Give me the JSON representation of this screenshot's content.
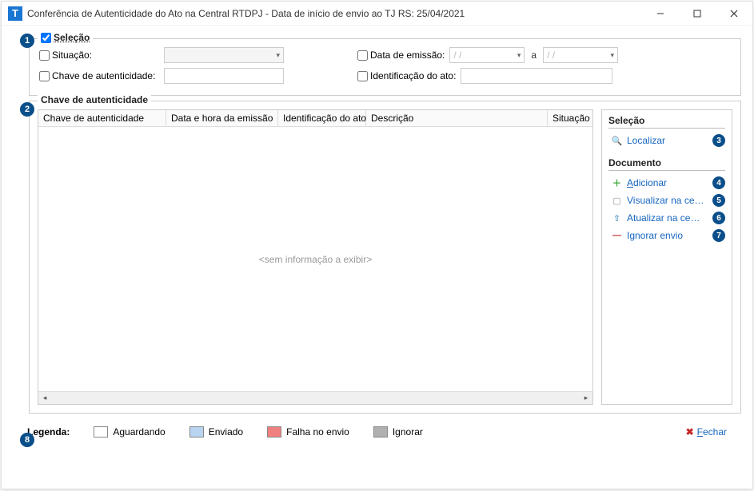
{
  "titlebar": {
    "app_icon_letter": "T",
    "title": "Conferência de Autenticidade do Ato na Central RTDPJ - Data de início de envio ao TJ RS: 25/04/2021"
  },
  "filters": {
    "legend": "Seleção",
    "situacao_label": "Situação:",
    "chave_label": "Chave de autenticidade:",
    "data_emissao_label": "Data de emissão:",
    "date_placeholder": "  /  /",
    "date_sep": "a",
    "ident_label": "Identificação do ato:"
  },
  "table": {
    "legend": "Chave de autenticidade",
    "columns": {
      "chave": "Chave de autenticidade",
      "datahora": "Data e hora da emissão",
      "ident": "Identificação do ato",
      "descricao": "Descrição",
      "situacao": "Situação"
    },
    "empty": "<sem informação a exibir>"
  },
  "sidepanel": {
    "selecao": {
      "title": "Seleção",
      "localizar": "Localizar"
    },
    "documento": {
      "title": "Documento",
      "adicionar": "Adicionar",
      "visualizar": "Visualizar na central...",
      "atualizar": "Atualizar na central...",
      "ignorar": "Ignorar envio"
    }
  },
  "legend": {
    "title": "Legenda:",
    "aguardando": "Aguardando",
    "enviado": "Enviado",
    "falha": "Falha no envio",
    "ignorar": "Ignorar"
  },
  "footer": {
    "fechar": "Fechar"
  },
  "badges": {
    "b1": "1",
    "b2": "2",
    "b3": "3",
    "b4": "4",
    "b5": "5",
    "b6": "6",
    "b7": "7",
    "b8": "8"
  }
}
